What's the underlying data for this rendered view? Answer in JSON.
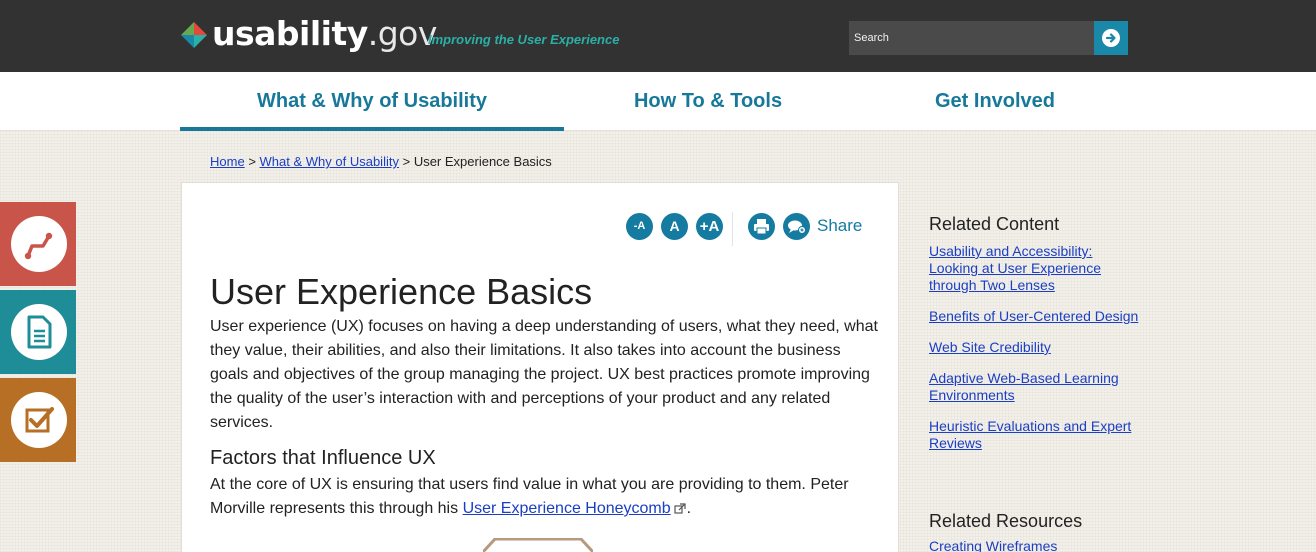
{
  "header": {
    "logo_name": "usability",
    "logo_tld": ".gov",
    "tagline": "Improving the User Experience",
    "search": {
      "placeholder": "Search",
      "button_icon": "arrow-right-icon"
    },
    "colors": {
      "bar": "#323232",
      "accent": "#2ab0a7",
      "button": "#1a88a8"
    }
  },
  "nav": {
    "tabs": [
      {
        "label": "What & Why of Usability",
        "active": true
      },
      {
        "label": "How To & Tools",
        "active": false
      },
      {
        "label": "Get Involved",
        "active": false
      }
    ]
  },
  "breadcrumb": {
    "home": "Home",
    "sep1": ">",
    "section": "What & Why of Usability",
    "sep2": ">",
    "current": "User Experience Basics"
  },
  "side_tiles": [
    {
      "icon": "route-icon",
      "color": "#c9544a"
    },
    {
      "icon": "document-icon",
      "color": "#1e8d98"
    },
    {
      "icon": "checklist-icon",
      "color": "#b66f24"
    }
  ],
  "toolbar": {
    "decrease_text": "-A",
    "reset_text": "A",
    "increase_text": "+A",
    "print_icon": "print-icon",
    "share_icon": "share-icon",
    "share_label": "Share"
  },
  "article": {
    "title": "User Experience Basics",
    "intro": "User experience (UX) focuses on having a deep understanding of users, what they need, what they value, their abilities, and also their limitations.  It also takes into account the business goals and objectives of the group managing the project. UX best practices promote improving the quality of the user’s interaction with and perceptions of your product and any related services.",
    "section_heading": "Factors that Influence UX",
    "section_text_before": "At the core of UX is ensuring that users find value in what you are providing to them.  Peter Morville represents this through his ",
    "section_link": "User Experience Honeycomb",
    "section_text_after": "."
  },
  "sidebar": {
    "related_content_heading": "Related Content",
    "related_content": [
      "Usability and Accessibility: Looking at User Experience through Two Lenses",
      "Benefits of User-Centered Design",
      "Web Site Credibility",
      "Adaptive Web-Based Learning Environments",
      "Heuristic Evaluations and Expert Reviews"
    ],
    "related_resources_heading": "Related Resources",
    "related_resources": [
      "Creating Wireframes"
    ]
  }
}
